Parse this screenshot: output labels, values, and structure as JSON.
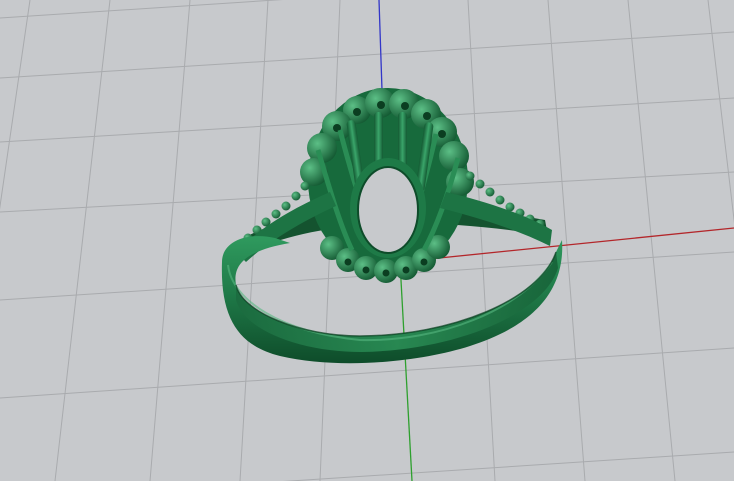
{
  "viewport": {
    "view": "perspective",
    "background_color": "#c7c9cc",
    "grid_color": "#a9abae",
    "x_axis_color": "#b3262a",
    "y_axis_color": "#2ea02e",
    "z_axis_color": "#3236c8"
  },
  "model": {
    "object": "ring",
    "parts": [
      "shank",
      "halo-setting",
      "gallery",
      "prongs",
      "pave-bead-row"
    ],
    "material_color": "#1f7a48",
    "shade_dark": "#0c4526",
    "shade_light": "#4fb17a"
  }
}
